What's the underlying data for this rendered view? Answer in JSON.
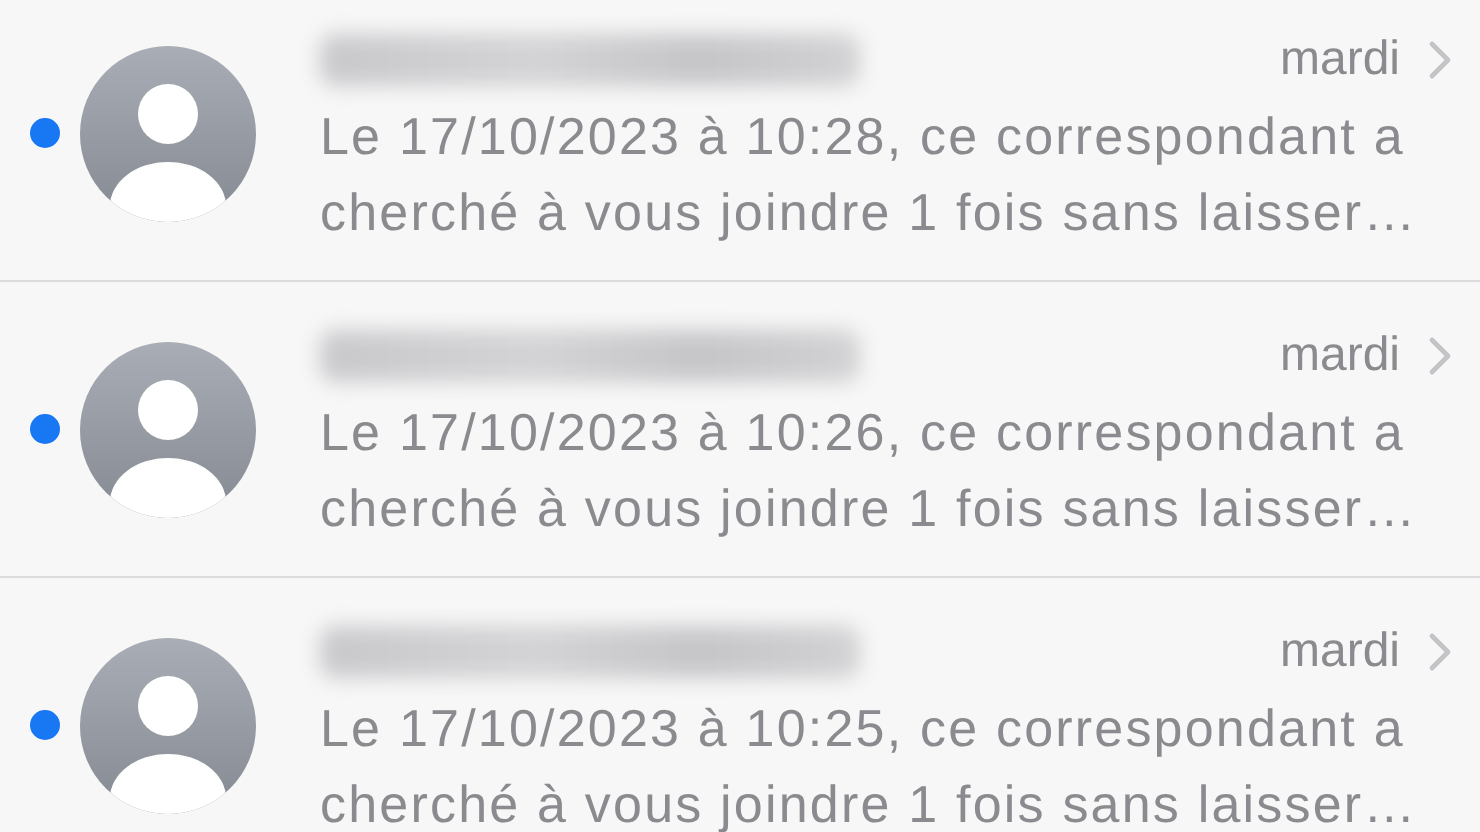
{
  "conversations": [
    {
      "unread": true,
      "sender_redacted": true,
      "date": "mardi",
      "message": "Le 17/10/2023 à 10:28, ce correspondant a cherché à vous joindre 1 fois sans laisser…"
    },
    {
      "unread": true,
      "sender_redacted": true,
      "date": "mardi",
      "message": "Le 17/10/2023 à 10:26, ce correspondant a cherché à vous joindre 1 fois sans laisser…"
    },
    {
      "unread": true,
      "sender_redacted": true,
      "date": "mardi",
      "message": "Le 17/10/2023 à 10:25, ce correspondant a cherché à vous joindre 1 fois sans laisser…"
    }
  ]
}
